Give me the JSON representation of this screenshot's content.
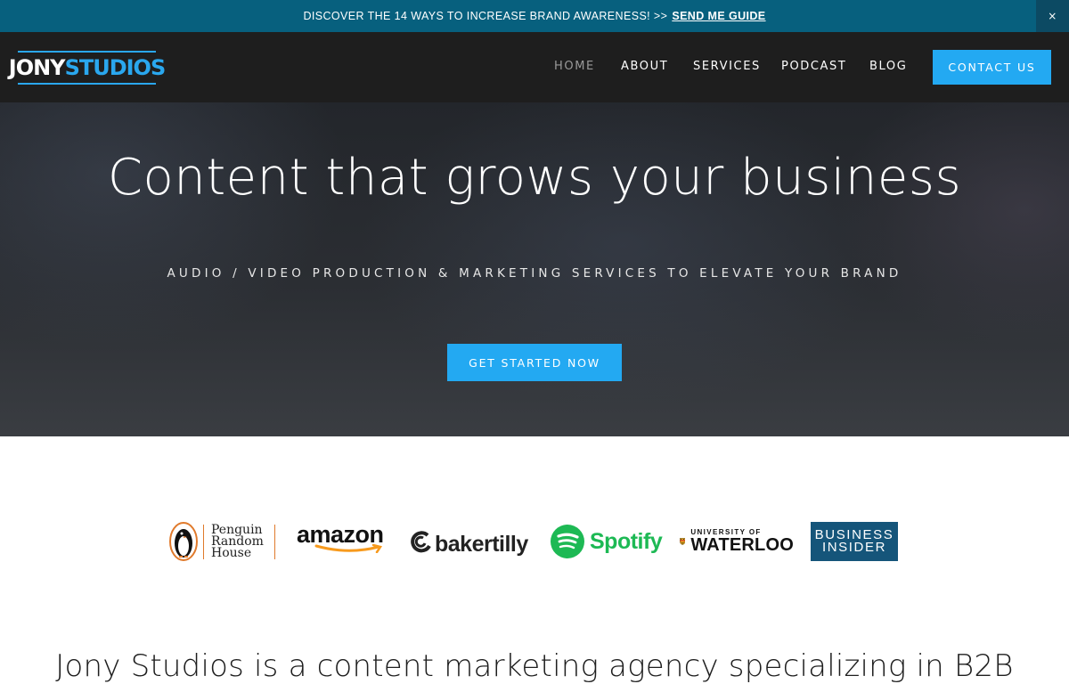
{
  "announcement": {
    "text": "DISCOVER THE 14 WAYS TO INCREASE BRAND AWARENESS! >>",
    "cta": "SEND ME GUIDE",
    "close_label": "×"
  },
  "header": {
    "logo_part1": "JONY",
    "logo_part2": "STUDIOS",
    "nav": [
      {
        "label": "HOME",
        "active": true
      },
      {
        "label": "ABOUT",
        "active": false
      },
      {
        "label": "SERVICES",
        "active": false
      },
      {
        "label": "PODCAST",
        "active": false
      },
      {
        "label": "BLOG",
        "active": false
      }
    ],
    "contact_label": "CONTACT US"
  },
  "hero": {
    "title": "Content that grows your business",
    "subtitle": "AUDIO / VIDEO PRODUCTION & MARKETING SERVICES TO ELEVATE YOUR BRAND",
    "cta": "GET STARTED NOW"
  },
  "clients": {
    "penguin": [
      "Penguin",
      "Random",
      "House"
    ],
    "amazon": "amazon",
    "bakertilly": "bakertilly",
    "spotify": "Spotify",
    "waterloo_small": "UNIVERSITY OF",
    "waterloo_big": "WATERLOO",
    "business_insider": [
      "BUSINESS",
      "INSIDER"
    ]
  },
  "intro": {
    "text": "Jony Studios is a content marketing agency specializing in B2B"
  },
  "colors": {
    "announce_bg": "#07607e",
    "header_bg": "#1e1e1e",
    "accent": "#23a9f2",
    "spotify_green": "#1db954",
    "bi_blue": "#15557a"
  }
}
